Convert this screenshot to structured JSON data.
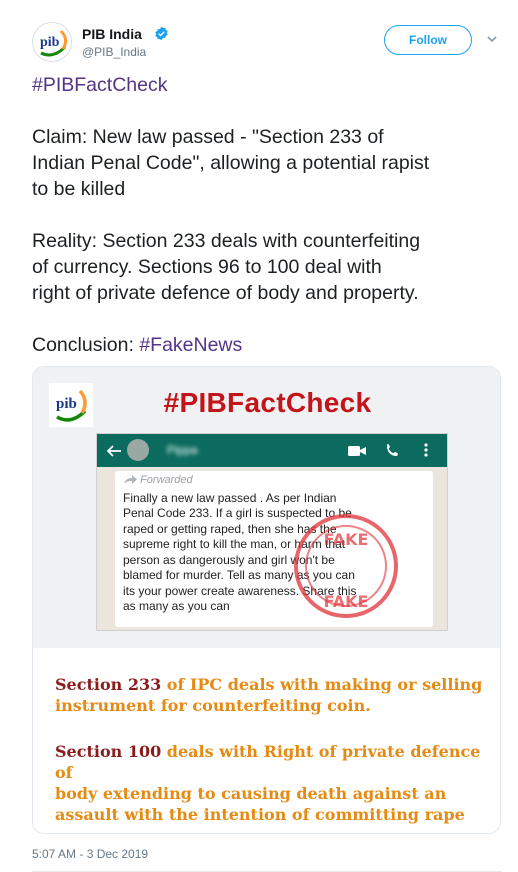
{
  "header": {
    "display_name": "PIB India",
    "handle": "@PIB_India",
    "follow_label": "Follow",
    "logo_text": "pib"
  },
  "tweet": {
    "hashtag_line": "#PIBFactCheck",
    "claim_lines": [
      "Claim: New law passed -  \"Section 233 of",
      "Indian Penal Code\", allowing a potential rapist",
      "to be killed"
    ],
    "reality_lines": [
      "Reality: Section 233 deals with counterfeiting",
      "of currency.  Sections 96 to 100 deal with",
      "right of private defence of body and property."
    ],
    "conclusion_label": "Conclusion: ",
    "conclusion_hashtag": "#FakeNews"
  },
  "card": {
    "title": "#PIBFactCheck",
    "logo_text": "pib",
    "contact_name": "Pippa",
    "forwarded_label": "Forwarded",
    "message_lines": [
      "Finally a new law passed . As per Indian",
      "Penal Code 233. If a girl is suspected to be",
      "raped or getting raped, then she has the",
      "supreme right to kill the man, or harm that",
      "person as dangerously and girl won't be",
      "blamed for murder. Tell as many as you can",
      "its your power create awareness. Share this",
      "as many as you can"
    ],
    "stamp_text": "FAKE",
    "section1_ref": "Section 233",
    "section1_rest": " of IPC deals with making or selling",
    "section1_line2": "instrument for counterfeiting coin.",
    "section2_ref": "Section 100",
    "section2_rest": " deals with Right of private defence of",
    "section2_line2": "body extending to causing death against an",
    "section2_line3": "assault with the intention of committing rape"
  },
  "footer": {
    "timestamp": "5:07 AM - 3 Dec 2019"
  },
  "colors": {
    "brand_blue": "#1da1f2",
    "hashtag_purple": "#553388",
    "fact_check_red": "#c2151b",
    "whatsapp_green": "#0b6b5e",
    "section_orange": "#e58a12",
    "section_ref_maroon": "#8b1c1c"
  },
  "icons": [
    "verified-badge-icon",
    "chevron-down-icon",
    "back-arrow-icon",
    "video-call-icon",
    "phone-call-icon",
    "more-options-icon",
    "forward-arrow-icon"
  ]
}
